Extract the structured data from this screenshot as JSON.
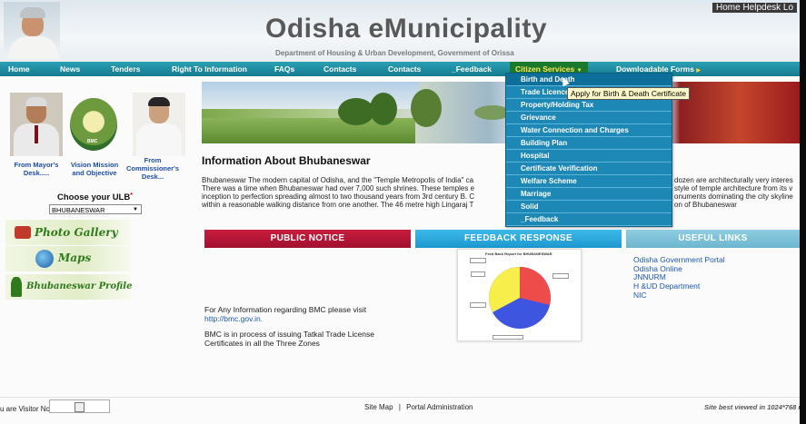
{
  "header": {
    "title": "Odisha eMunicipality",
    "subtitle": "Department of Housing & Urban Development, Government of Orissa",
    "top_links": "Home Helpdesk Lo"
  },
  "nav": {
    "items": [
      "Home",
      "News",
      "Tenders",
      "Right To Information",
      "FAQs",
      "Contacts",
      "Contacts",
      "_Feedback"
    ],
    "citizen_services": "Citizen Services",
    "downloadable_forms": "Downloadable Forms"
  },
  "dropdown": {
    "items": [
      "Birth and Death",
      "Trade Licence",
      "Property/Holding Tax",
      "Grievance",
      "Water Connection and Charges",
      "Building Plan",
      "Hospital",
      "Certificate Verification",
      "Welfare Scheme",
      "Marriage",
      "Solid",
      "_Feedback"
    ],
    "tooltip": "Apply for Birth & Death Certificate"
  },
  "left": {
    "mayor": "From Mayor's Desk.....",
    "vision": "Vision Mission and Objective",
    "commissioner": "From Commissioner's Desk...",
    "emblem_text": "BMC",
    "choose_label": "Choose your ULB",
    "ulb_selected": "BHUBANESWAR",
    "photo_gallery": "Photo Gallery",
    "maps": "Maps",
    "profile": "Bhubaneswar Profile"
  },
  "article": {
    "title": "Information About Bhubaneswar",
    "lines": [
      "Bhubaneswar The modern capital of Odisha, and the \"Temple Metropolis of India\" ca",
      "There was a time when Bhubaneswar had over 7,000 such shrines. These temples e",
      "inception to perfection spreading almost to two thousand years from 3rd century B. C",
      "within a reasonable walking distance from one another. The 46 metre high Lingaraj T"
    ],
    "lines_right": [
      "dozen are architecturally very interes",
      "style of temple architecture from its v",
      "onuments dominating the city skyline",
      "on of Bhubaneswar"
    ]
  },
  "sections": {
    "public_notice": "PUBLIC NOTICE",
    "feedback_response": "FEEDBACK RESPONSE",
    "useful_links": "USEFUL LINKS"
  },
  "public_notice": {
    "line1": "For Any Information regarding BMC please visit",
    "line2": "http://bmc.gov.in.",
    "line3": "BMC is in process of issuing Tatkal Trade License",
    "line4": "Certificates in all the Three Zones"
  },
  "feedback_chart": {
    "title": "Feed Back Report for BHUBANESWAR"
  },
  "useful_links": [
    "Odisha Government Portal",
    "Odisha Online",
    "JNNURM",
    "H &UD Department",
    "NIC"
  ],
  "footer": {
    "visitor": "u are Visitor No:",
    "site_map": "Site Map",
    "sep": "|",
    "portal_admin": "Portal Administration",
    "best_viewed": "Site best viewed in 1024*768 r"
  },
  "colors": {
    "nav": "#1d8fa4",
    "public_notice": "#b5163a",
    "feedback": "#2aa9dc",
    "useful": "#7cc0d6",
    "dropdown": "#1d87b6"
  }
}
